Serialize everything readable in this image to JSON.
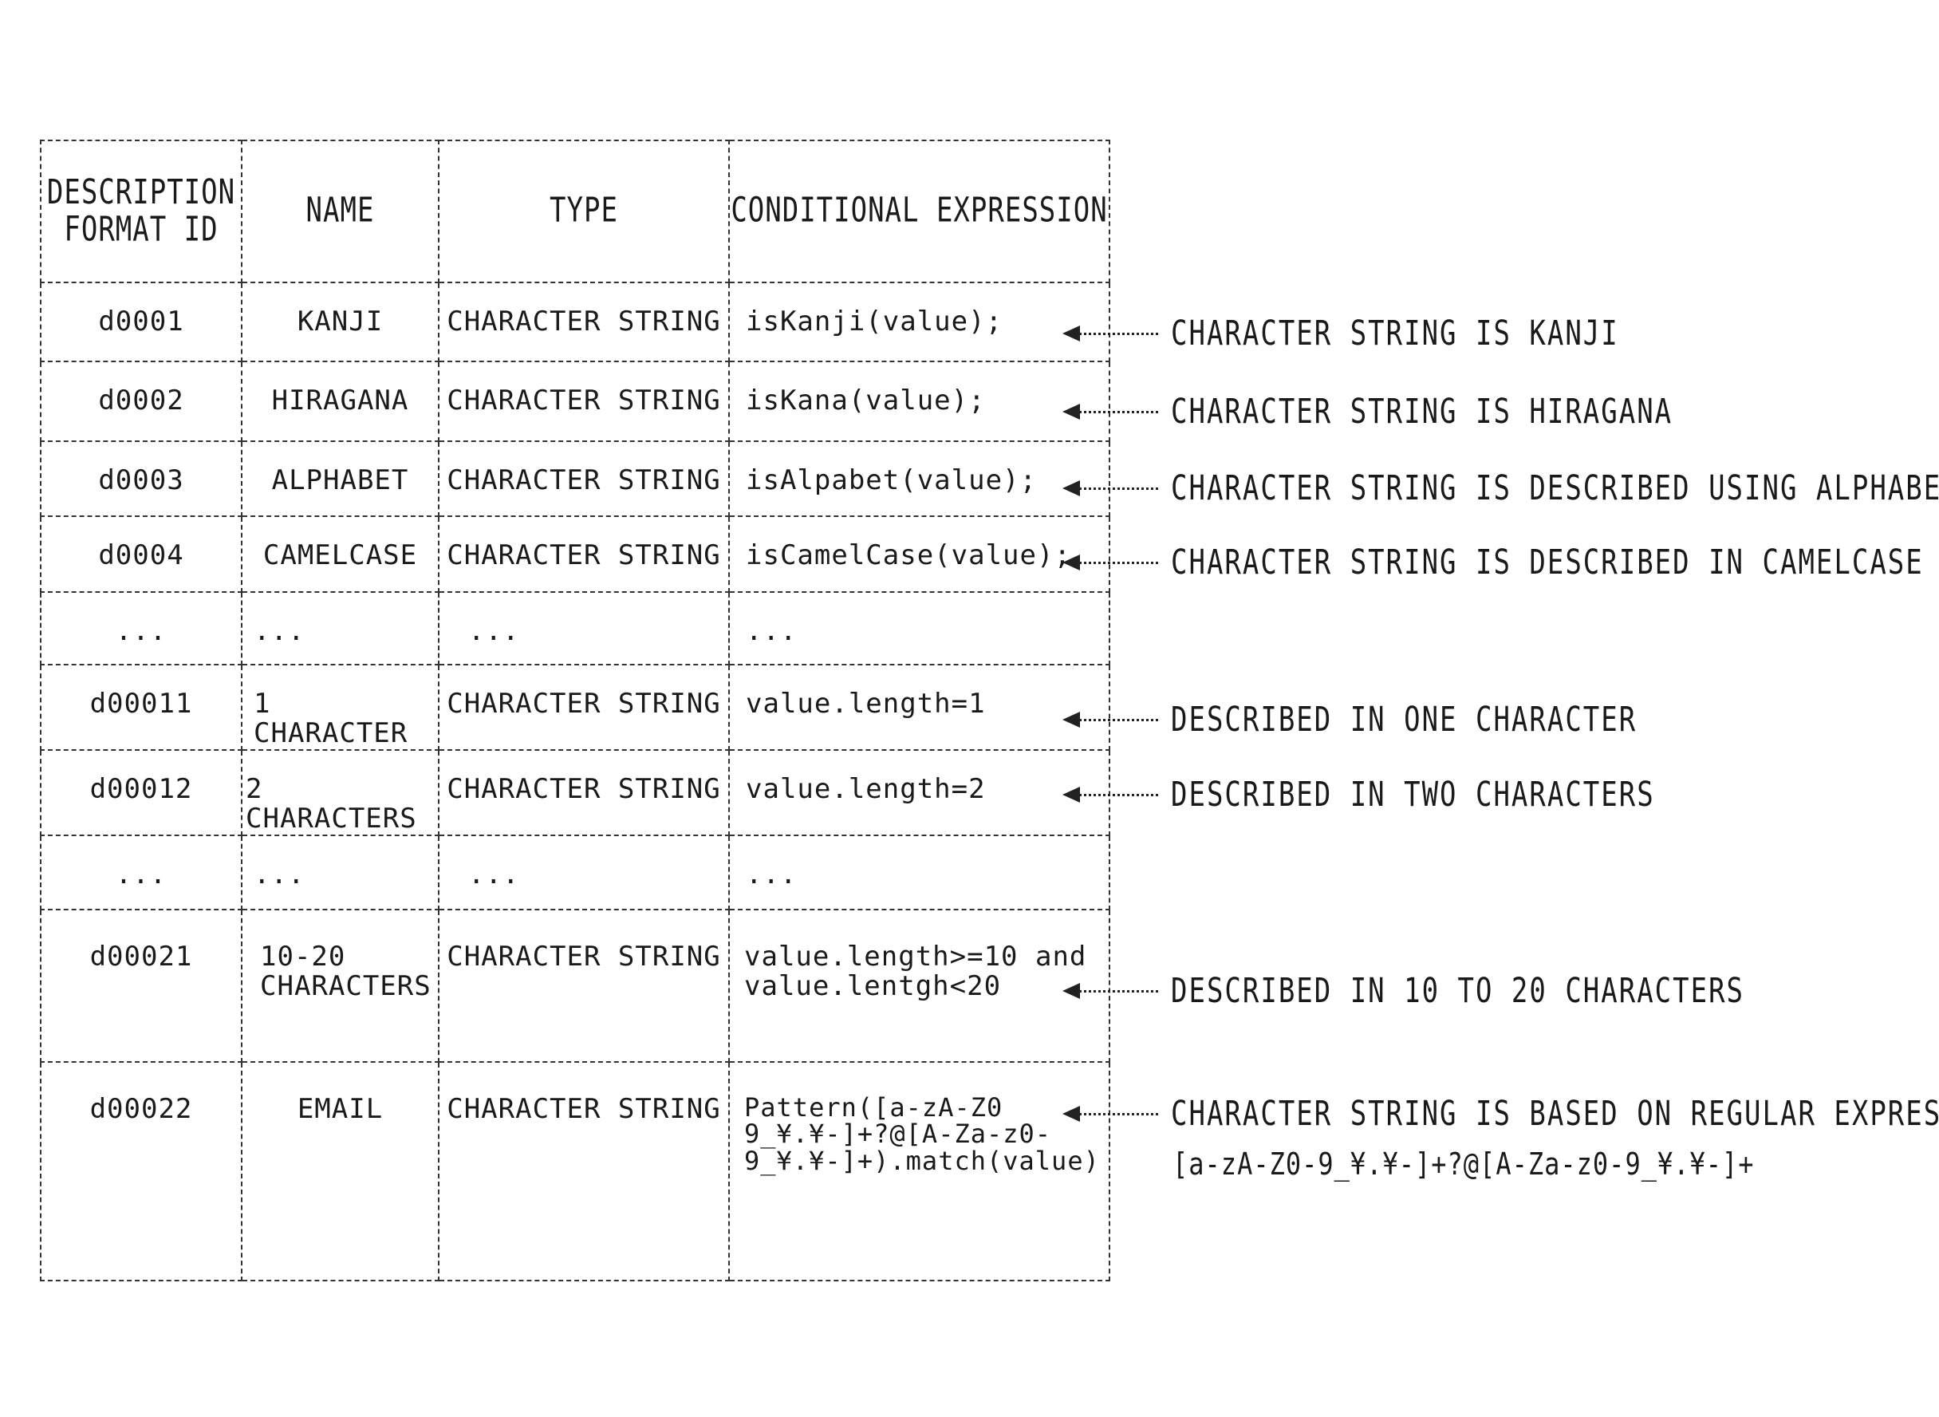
{
  "table": {
    "headers": {
      "id": "DESCRIPTION\nFORMAT ID",
      "name": "NAME",
      "type": "TYPE",
      "expr": "CONDITIONAL EXPRESSION"
    },
    "rows": [
      {
        "id": "d0001",
        "name": "KANJI",
        "type": "CHARACTER STRING",
        "expr": "isKanji(value);"
      },
      {
        "id": "d0002",
        "name": "HIRAGANA",
        "type": "CHARACTER STRING",
        "expr": "isKana(value);"
      },
      {
        "id": "d0003",
        "name": "ALPHABET",
        "type": "CHARACTER STRING",
        "expr": "isAlpabet(value);"
      },
      {
        "id": "d0004",
        "name": "CAMELCASE",
        "type": "CHARACTER STRING",
        "expr": "isCamelCase(value);"
      },
      {
        "id": "...",
        "name": "...",
        "type": "...",
        "expr": "..."
      },
      {
        "id": "d00011",
        "name": "1 CHARACTER",
        "type": "CHARACTER STRING",
        "expr": "value.length=1"
      },
      {
        "id": "d00012",
        "name": "2 CHARACTERS",
        "type": "CHARACTER STRING",
        "expr": "value.length=2"
      },
      {
        "id": "...",
        "name": "...",
        "type": "...",
        "expr": "..."
      },
      {
        "id": "d00021",
        "name": "10-20\nCHARACTERS",
        "type": "CHARACTER STRING",
        "expr": "value.length>=10 and\nvalue.lentgh<20"
      },
      {
        "id": "d00022",
        "name": "EMAIL",
        "type": "CHARACTER STRING",
        "expr": "Pattern([a-zA-Z0\n9_¥.¥-]+?@[A-Za-z0-\n9_¥.¥-]+).match(value)"
      }
    ]
  },
  "annotations": [
    {
      "text": "CHARACTER STRING IS KANJI"
    },
    {
      "text": "CHARACTER STRING IS HIRAGANA"
    },
    {
      "text": "CHARACTER STRING IS DESCRIBED USING ALPHABETS"
    },
    {
      "text": "CHARACTER STRING IS DESCRIBED IN CAMELCASE"
    },
    {
      "text": "DESCRIBED IN ONE CHARACTER"
    },
    {
      "text": "DESCRIBED IN TWO CHARACTERS"
    },
    {
      "text": "DESCRIBED IN 10 TO 20 CHARACTERS"
    },
    {
      "text": "CHARACTER STRING IS BASED ON REGULAR EXPRESSION",
      "sub": "[a-zA-Z0-9_¥.¥-]+?@[A-Za-z0-9_¥.¥-]+"
    }
  ],
  "icons": {
    "arrow": "left-arrow-icon"
  }
}
